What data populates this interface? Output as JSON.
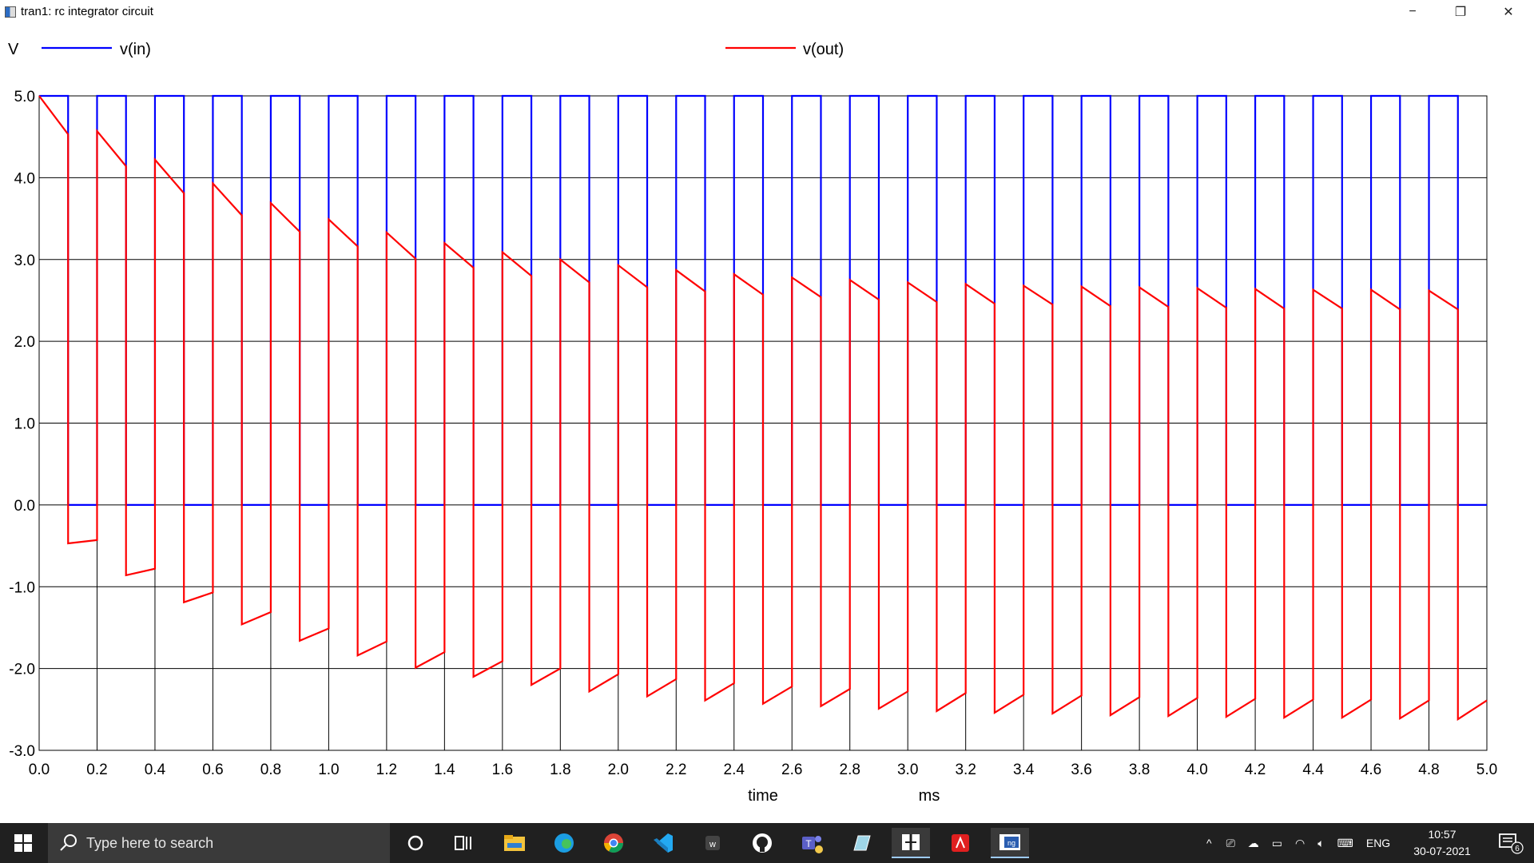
{
  "window": {
    "title": "tran1: rc integrator circuit",
    "controls": {
      "minimize": "−",
      "maximize": "❐",
      "close": "✕"
    }
  },
  "chart_data": {
    "type": "line",
    "title": "",
    "xlabel": "time",
    "xunit": "ms",
    "ylabel": "V",
    "xlim": [
      0,
      5.0
    ],
    "ylim": [
      -3.0,
      5.0
    ],
    "xticks": [
      "0.0",
      "0.2",
      "0.4",
      "0.6",
      "0.8",
      "1.0",
      "1.2",
      "1.4",
      "1.6",
      "1.8",
      "2.0",
      "2.2",
      "2.4",
      "2.6",
      "2.8",
      "3.0",
      "3.2",
      "3.4",
      "3.6",
      "3.8",
      "4.0",
      "4.2",
      "4.4",
      "4.6",
      "4.8",
      "5.0"
    ],
    "yticks": [
      "5.0",
      "4.0",
      "3.0",
      "2.0",
      "1.0",
      "0.0",
      "-1.0",
      "-2.0",
      "-3.0"
    ],
    "grid": true,
    "legend_placement": "top",
    "series": [
      {
        "name": "v(in)",
        "color": "#0000ff",
        "kind": "square_wave",
        "period_ms": 0.2,
        "high": 5.0,
        "low": 0.0,
        "high_duration_ms": 0.1
      },
      {
        "name": "v(out)",
        "color": "#ff0000",
        "kind": "rc_output",
        "high_segments": [
          {
            "t": 0.0,
            "start": 5.0,
            "end": 4.53
          },
          {
            "t": 0.2,
            "start": 4.57,
            "end": 4.14
          },
          {
            "t": 0.4,
            "start": 4.22,
            "end": 3.81
          },
          {
            "t": 0.6,
            "start": 3.93,
            "end": 3.54
          },
          {
            "t": 0.8,
            "start": 3.69,
            "end": 3.34
          },
          {
            "t": 1.0,
            "start": 3.49,
            "end": 3.16
          },
          {
            "t": 1.2,
            "start": 3.33,
            "end": 3.01
          },
          {
            "t": 1.4,
            "start": 3.2,
            "end": 2.9
          },
          {
            "t": 1.6,
            "start": 3.09,
            "end": 2.8
          },
          {
            "t": 1.8,
            "start": 3.0,
            "end": 2.72
          },
          {
            "t": 2.0,
            "start": 2.93,
            "end": 2.66
          },
          {
            "t": 2.2,
            "start": 2.87,
            "end": 2.61
          },
          {
            "t": 2.4,
            "start": 2.82,
            "end": 2.57
          },
          {
            "t": 2.6,
            "start": 2.78,
            "end": 2.54
          },
          {
            "t": 2.8,
            "start": 2.75,
            "end": 2.51
          },
          {
            "t": 3.0,
            "start": 2.72,
            "end": 2.48
          },
          {
            "t": 3.2,
            "start": 2.7,
            "end": 2.46
          },
          {
            "t": 3.4,
            "start": 2.68,
            "end": 2.45
          },
          {
            "t": 3.6,
            "start": 2.67,
            "end": 2.43
          },
          {
            "t": 3.8,
            "start": 2.66,
            "end": 2.42
          },
          {
            "t": 4.0,
            "start": 2.65,
            "end": 2.41
          },
          {
            "t": 4.2,
            "start": 2.64,
            "end": 2.4
          },
          {
            "t": 4.4,
            "start": 2.63,
            "end": 2.4
          },
          {
            "t": 4.6,
            "start": 2.63,
            "end": 2.39
          },
          {
            "t": 4.8,
            "start": 2.62,
            "end": 2.39
          }
        ],
        "low_segments": [
          {
            "t": 0.1,
            "start": -0.47,
            "end": -0.43
          },
          {
            "t": 0.3,
            "start": -0.86,
            "end": -0.78
          },
          {
            "t": 0.5,
            "start": -1.19,
            "end": -1.07
          },
          {
            "t": 0.7,
            "start": -1.46,
            "end": -1.31
          },
          {
            "t": 0.9,
            "start": -1.66,
            "end": -1.51
          },
          {
            "t": 1.1,
            "start": -1.84,
            "end": -1.67
          },
          {
            "t": 1.3,
            "start": -1.99,
            "end": -1.8
          },
          {
            "t": 1.5,
            "start": -2.1,
            "end": -1.91
          },
          {
            "t": 1.7,
            "start": -2.2,
            "end": -2.0
          },
          {
            "t": 1.9,
            "start": -2.28,
            "end": -2.07
          },
          {
            "t": 2.1,
            "start": -2.34,
            "end": -2.13
          },
          {
            "t": 2.3,
            "start": -2.39,
            "end": -2.18
          },
          {
            "t": 2.5,
            "start": -2.43,
            "end": -2.22
          },
          {
            "t": 2.7,
            "start": -2.46,
            "end": -2.25
          },
          {
            "t": 2.9,
            "start": -2.49,
            "end": -2.28
          },
          {
            "t": 3.1,
            "start": -2.52,
            "end": -2.3
          },
          {
            "t": 3.3,
            "start": -2.54,
            "end": -2.32
          },
          {
            "t": 3.5,
            "start": -2.55,
            "end": -2.33
          },
          {
            "t": 3.7,
            "start": -2.57,
            "end": -2.35
          },
          {
            "t": 3.9,
            "start": -2.58,
            "end": -2.36
          },
          {
            "t": 4.1,
            "start": -2.59,
            "end": -2.37
          },
          {
            "t": 4.3,
            "start": -2.6,
            "end": -2.38
          },
          {
            "t": 4.5,
            "start": -2.6,
            "end": -2.38
          },
          {
            "t": 4.7,
            "start": -2.61,
            "end": -2.39
          },
          {
            "t": 4.9,
            "start": -2.62,
            "end": -2.39
          }
        ]
      }
    ]
  },
  "taskbar": {
    "search_placeholder": "Type here to search",
    "icons": [
      "cortana-icon",
      "task-view-icon",
      "file-explorer-icon",
      "edge-icon",
      "chrome-icon",
      "vscode-icon",
      "app-icon",
      "github-icon",
      "teams-icon",
      "notepad-icon",
      "terminal-app-icon",
      "acrobat-icon",
      "ngspice-icon"
    ],
    "tray_language": "ENG",
    "clock_time": "10:57",
    "clock_date": "30-07-2021",
    "notification_count": "6"
  }
}
